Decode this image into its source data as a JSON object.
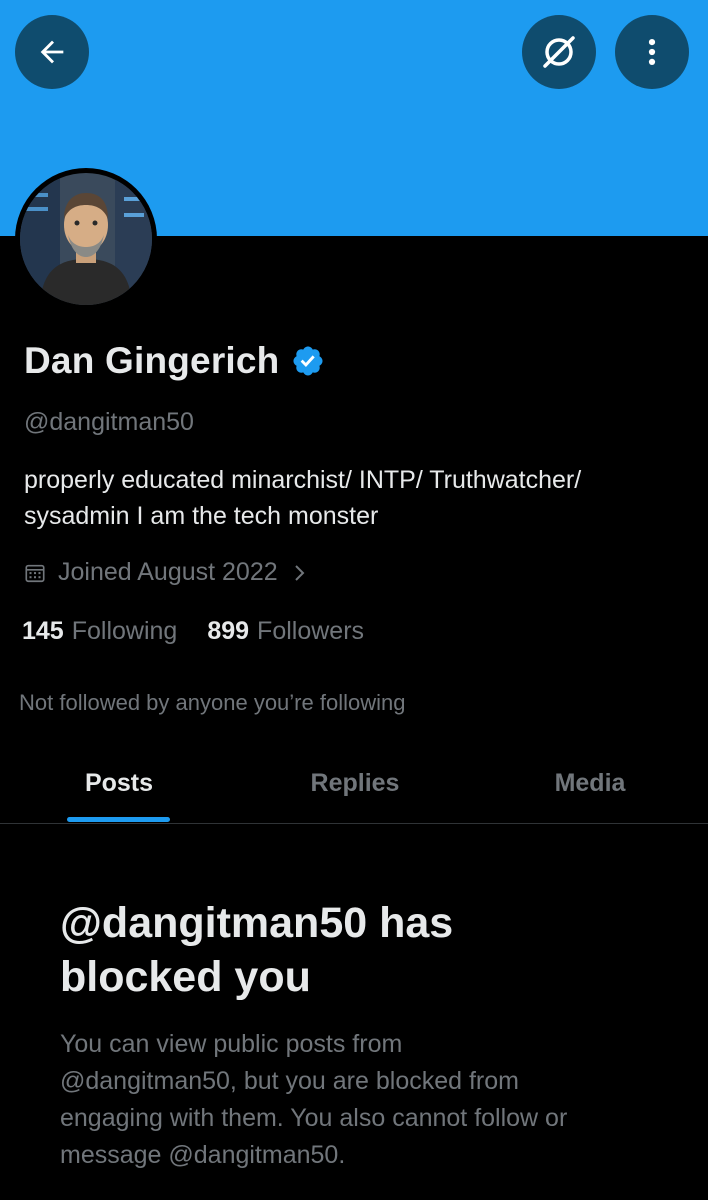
{
  "colors": {
    "banner": "#1d9bf0",
    "background": "#000000",
    "accent": "#1d9bf0",
    "text_primary": "#e7e9ea",
    "text_secondary": "#71767b"
  },
  "header": {
    "back_icon": "arrow-left-icon",
    "grok_icon": "grok-icon",
    "more_icon": "more-vertical-icon"
  },
  "profile": {
    "display_name": "Dan Gingerich",
    "verified": true,
    "handle": "@dangitman50",
    "bio_line1": "properly educated minarchist/ INTP/ Truthwatcher/",
    "bio_line2": "sysadmin I am the tech monster",
    "joined": "Joined August 2022",
    "following_count": "145",
    "following_label": "Following",
    "followers_count": "899",
    "followers_label": "Followers",
    "not_followed": "Not followed by anyone you’re following"
  },
  "tabs": [
    {
      "label": "Posts",
      "active": true
    },
    {
      "label": "Replies",
      "active": false
    },
    {
      "label": "Media",
      "active": false
    }
  ],
  "blocked": {
    "title_line1": "@dangitman50 has",
    "title_line2": "blocked you",
    "desc_line1": "You can view public posts from",
    "desc_line2": "@dangitman50, but you are blocked from",
    "desc_line3": "engaging with them. You also cannot follow or",
    "desc_line4": "message @dangitman50."
  }
}
